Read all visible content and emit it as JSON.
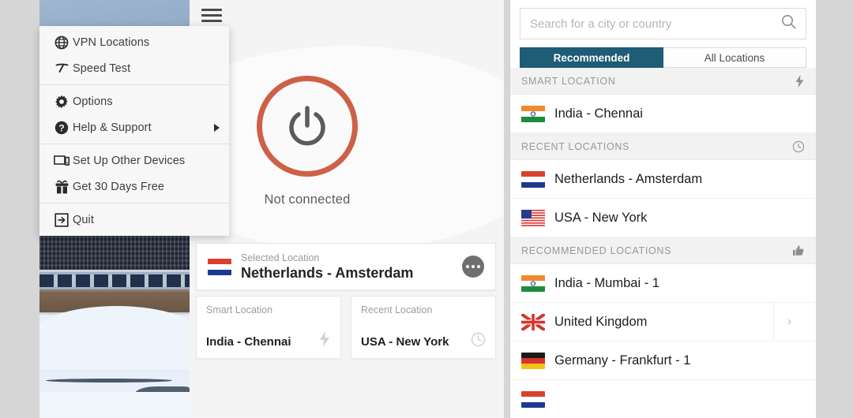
{
  "app": {
    "menu_button": "hamburger-menu",
    "status_text": "Not connected",
    "power_icon": "power-icon"
  },
  "menu": {
    "groups": [
      {
        "items": [
          {
            "icon": "globe-icon",
            "label": "VPN Locations",
            "submenu": false
          },
          {
            "icon": "speedometer-icon",
            "label": "Speed Test",
            "submenu": false
          }
        ]
      },
      {
        "items": [
          {
            "icon": "gear-icon",
            "label": "Options",
            "submenu": false
          },
          {
            "icon": "help-circle-icon",
            "label": "Help & Support",
            "submenu": true
          }
        ]
      },
      {
        "items": [
          {
            "icon": "devices-icon",
            "label": "Set Up Other Devices",
            "submenu": false
          },
          {
            "icon": "gift-icon",
            "label": "Get 30 Days Free",
            "submenu": false
          }
        ]
      },
      {
        "items": [
          {
            "icon": "exit-icon",
            "label": "Quit",
            "submenu": false
          }
        ]
      }
    ]
  },
  "selected_location": {
    "label": "Selected Location",
    "value": "Netherlands - Amsterdam",
    "flag": "netherlands-flag",
    "more_button": "more-options-button"
  },
  "mini_cards": [
    {
      "label": "Smart Location",
      "value": "India - Chennai",
      "icon": "lightning-icon"
    },
    {
      "label": "Recent Location",
      "value": "USA - New York",
      "icon": "clock-icon"
    }
  ],
  "locations_panel": {
    "search": {
      "placeholder": "Search for a city or country",
      "value": "",
      "icon": "search-icon"
    },
    "tabs": [
      {
        "label": "Recommended",
        "active": true
      },
      {
        "label": "All Locations",
        "active": false
      }
    ],
    "sections": [
      {
        "title": "SMART LOCATION",
        "icon": "lightning-icon",
        "rows": [
          {
            "name": "India - Chennai",
            "flag": "india-flag",
            "chevron": false
          }
        ]
      },
      {
        "title": "RECENT LOCATIONS",
        "icon": "clock-icon",
        "rows": [
          {
            "name": "Netherlands - Amsterdam",
            "flag": "netherlands-flag",
            "chevron": false
          },
          {
            "name": "USA - New York",
            "flag": "usa-flag",
            "chevron": false
          }
        ]
      },
      {
        "title": "RECOMMENDED LOCATIONS",
        "icon": "thumbs-up-icon",
        "rows": [
          {
            "name": "India - Mumbai - 1",
            "flag": "india-flag",
            "chevron": false
          },
          {
            "name": "United Kingdom",
            "flag": "uk-flag",
            "chevron": true
          },
          {
            "name": "Germany - Frankfurt - 1",
            "flag": "germany-flag",
            "chevron": false
          },
          {
            "name": "",
            "flag": "netherlands-flag",
            "chevron": false
          }
        ]
      }
    ]
  },
  "colors": {
    "accent_power_ring": "#cd6047",
    "tab_active": "#1f5c75",
    "window_bg": "#f2f2f2",
    "page_bg": "#d6d6d6"
  }
}
